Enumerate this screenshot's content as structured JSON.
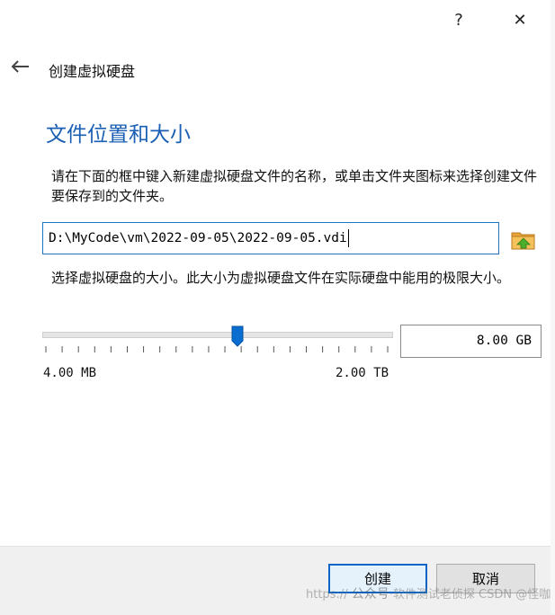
{
  "window": {
    "help_label": "?",
    "close_label": "✕"
  },
  "wizard": {
    "title": "创建虚拟硬盘",
    "back_icon": "arrow-left-icon"
  },
  "page": {
    "title": "文件位置和大小",
    "location_description": "请在下面的框中键入新建虚拟硬盘文件的名称，或单击文件夹图标来选择创建文件要保存到的文件夹。",
    "file_path": "D:\\MyCode\\vm\\2022-09-05\\2022-09-05.vdi",
    "folder_icon": "folder-icon",
    "size_description": "选择虚拟硬盘的大小。此大小为虚拟硬盘文件在实际硬盘中能用的极限大小。",
    "size_value": "8.00 GB",
    "size_slider_level": 0.56,
    "size_min_label": "4.00 MB",
    "size_max_label": "2.00 TB"
  },
  "buttons": {
    "create": "创建",
    "cancel": "取消"
  },
  "watermark": {
    "left": "https://",
    "wechat": "公众号",
    "middle": "·软件测试老侦探",
    "right": "CSDN @怪咖@"
  },
  "colors": {
    "accent": "#1a5fb4",
    "input_focus": "#1b75c4",
    "default_button_border": "#0a64c8",
    "footer_bg": "#f0f0f0"
  }
}
